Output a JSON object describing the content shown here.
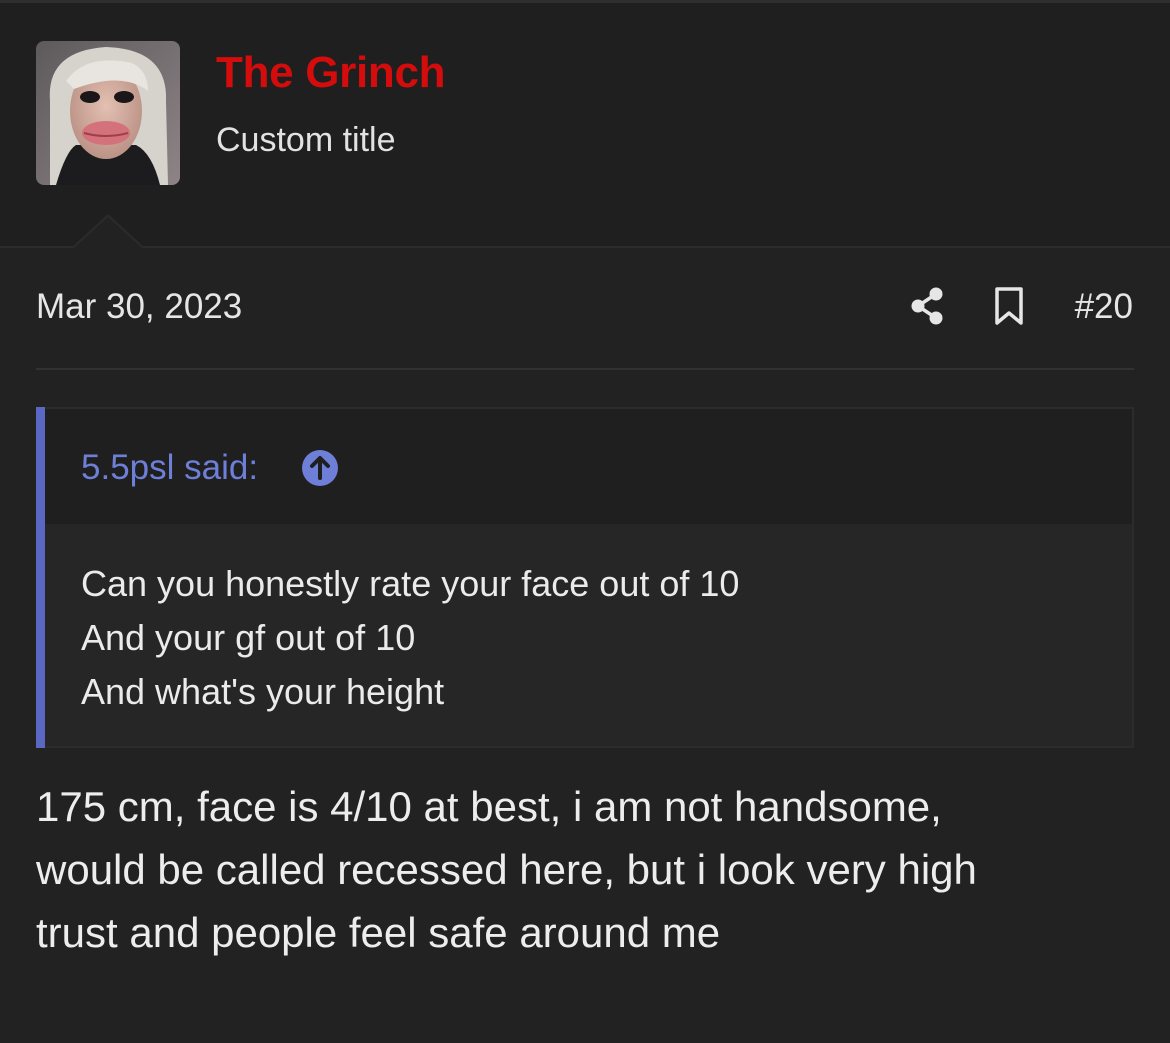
{
  "post": {
    "author": {
      "name": "The Grinch",
      "custom_title": "Custom title",
      "name_color": "#d50c0c",
      "avatar_icon": "avatar-photo"
    },
    "date": "Mar 30, 2023",
    "actions": {
      "share_icon": "share-icon",
      "bookmark_icon": "bookmark-icon",
      "post_number": "#20"
    },
    "quote": {
      "author_label": "5.5psl said:",
      "jump_icon": "arrow-up-circle-icon",
      "accent_color": "#5a68c4",
      "lines": [
        "Can you honestly rate your face out of 10",
        "And your gf out of 10",
        "And what's your height"
      ]
    },
    "body": {
      "lines": [
        "175 cm, face is 4/10 at best, i am not handsome,",
        "would be called recessed here, but i look very high",
        "trust and people feel safe around me"
      ]
    }
  }
}
